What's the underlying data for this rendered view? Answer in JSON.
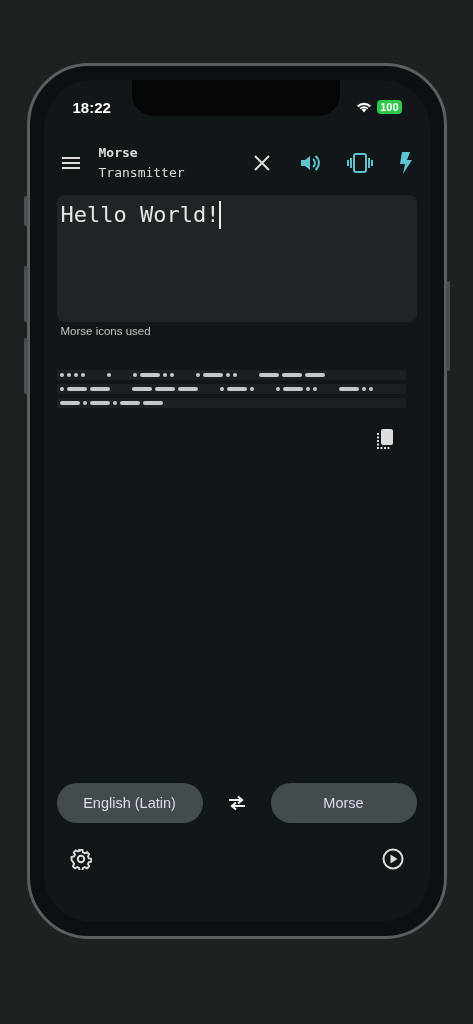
{
  "status_bar": {
    "time": "18:22",
    "battery": "100"
  },
  "toolbar": {
    "title": "Morse",
    "subtitle": "Transmitter",
    "sound_on": true,
    "vibration_on": true,
    "flash_on": true
  },
  "input": {
    "value": "Hello World!"
  },
  "caption": "Morse icons used",
  "languages": {
    "source": "English (Latin)",
    "target": "Morse"
  }
}
